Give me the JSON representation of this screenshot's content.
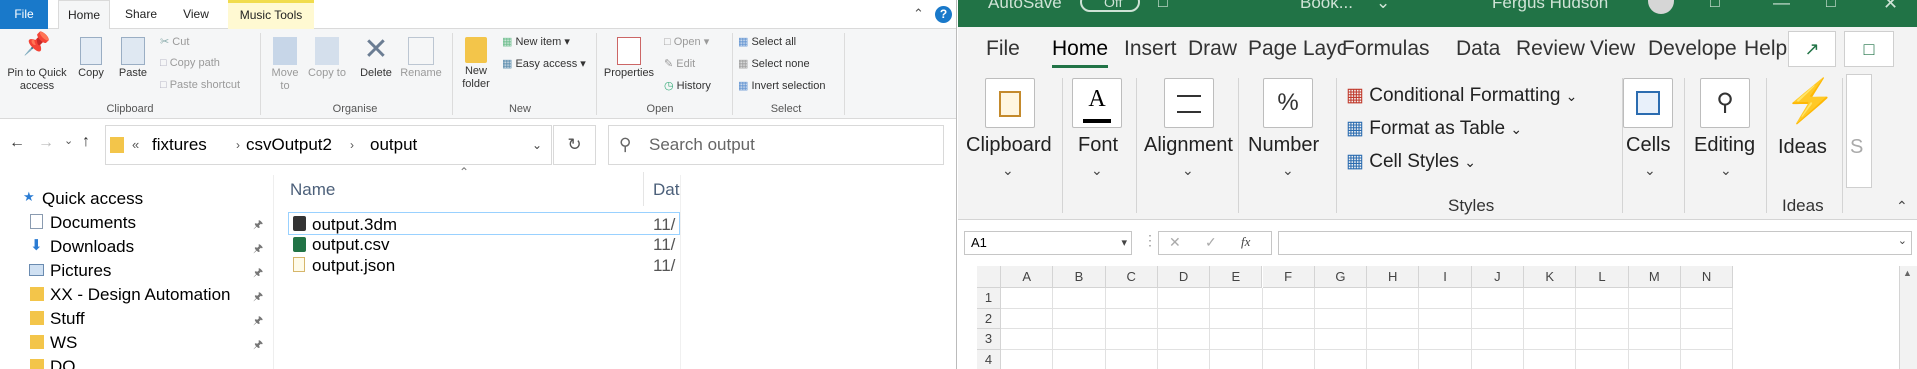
{
  "explorer": {
    "tabs": {
      "file": "File",
      "home": "Home",
      "share": "Share",
      "view": "View",
      "music_tools": "Music Tools"
    },
    "ribbon": {
      "pin_to_quick_access": "Pin to Quick access",
      "copy": "Copy",
      "paste": "Paste",
      "cut": "Cut",
      "copy_path": "Copy path",
      "paste_shortcut": "Paste shortcut",
      "move_to": "Move to",
      "copy_to": "Copy to",
      "delete": "Delete",
      "rename": "Rename",
      "new_folder": "New folder",
      "new_item": "New item",
      "easy_access": "Easy access",
      "properties": "Properties",
      "open": "Open",
      "edit": "Edit",
      "history": "History",
      "select_all": "Select all",
      "select_none": "Select none",
      "invert_selection": "Invert selection",
      "groups": {
        "clipboard": "Clipboard",
        "organise": "Organise",
        "new": "New",
        "open": "Open",
        "select": "Select"
      }
    },
    "address": {
      "crumbs": [
        "fixtures",
        "csvOutput2",
        "output"
      ],
      "overflow": "«"
    },
    "search": {
      "placeholder": "Search output"
    },
    "nav": [
      "Quick access",
      "Documents",
      "Downloads",
      "Pictures",
      "XX - Design Automation",
      "Stuff",
      "WS",
      "DO"
    ],
    "columns": {
      "name": "Name",
      "date": "Dat"
    },
    "files": [
      {
        "name": "output.3dm",
        "date": "11/"
      },
      {
        "name": "output.csv",
        "date": "11/"
      },
      {
        "name": "output.json",
        "date": "11/"
      }
    ]
  },
  "excel": {
    "title": {
      "autosave": "AutoSave",
      "toggle": "Off",
      "book": "Book...",
      "user": "Fergus Hudson"
    },
    "tabs": [
      "File",
      "Home",
      "Insert",
      "Draw",
      "Page Layo",
      "Formulas",
      "Data",
      "Review",
      "View",
      "Develope",
      "Help"
    ],
    "ribbon": {
      "clipboard": "Clipboard",
      "font": "Font",
      "alignment": "Alignment",
      "number": "Number",
      "conditional_formatting": "Conditional Formatting",
      "format_as_table": "Format as Table",
      "cell_styles": "Cell Styles",
      "styles_group": "Styles",
      "cells": "Cells",
      "editing": "Editing",
      "ideas": "Ideas",
      "ideas_group": "Ideas",
      "partial": "S"
    },
    "name_box": "A1",
    "fx": "fx",
    "columns": [
      "A",
      "B",
      "C",
      "D",
      "E",
      "F",
      "G",
      "H",
      "I",
      "J",
      "K",
      "L",
      "M",
      "N"
    ],
    "rows": [
      "1",
      "2",
      "3",
      "4"
    ],
    "colors": {
      "excel_green": "#217346",
      "explorer_blue": "#1979ca",
      "ideas_blue": "#2b88d8"
    }
  }
}
